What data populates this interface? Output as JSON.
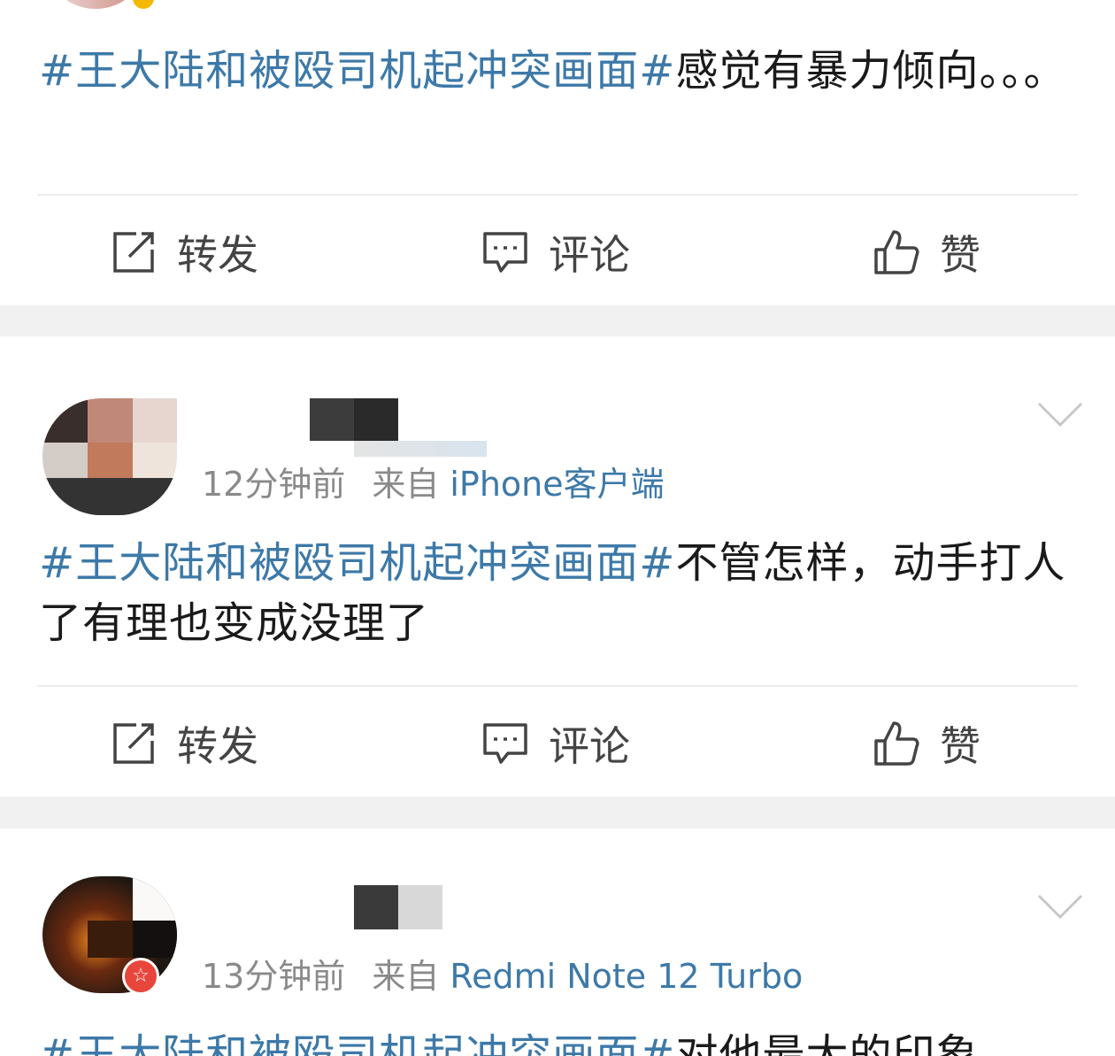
{
  "colors": {
    "topic": "#3d79a8",
    "text": "#1a1a1a",
    "meta": "#8a8a8a",
    "separator": "#f1f1f1"
  },
  "actions": {
    "repost_label": "转发",
    "comment_label": "评论",
    "like_label": "赞"
  },
  "posts": [
    {
      "topic": "#王大陆和被殴司机起冲突画面#",
      "body": "感觉有暴力倾向。。。"
    },
    {
      "time": "12分钟前",
      "from_label": "来自",
      "source": "iPhone客户端",
      "topic": "#王大陆和被殴司机起冲突画面#",
      "body": "不管怎样，动手打人了有理也变成没理了"
    },
    {
      "time": "13分钟前",
      "from_label": "来自",
      "source": "Redmi Note 12 Turbo",
      "topic": "#王大陆和被殴司机起冲突画面#",
      "body": "对他最大的印象"
    }
  ]
}
